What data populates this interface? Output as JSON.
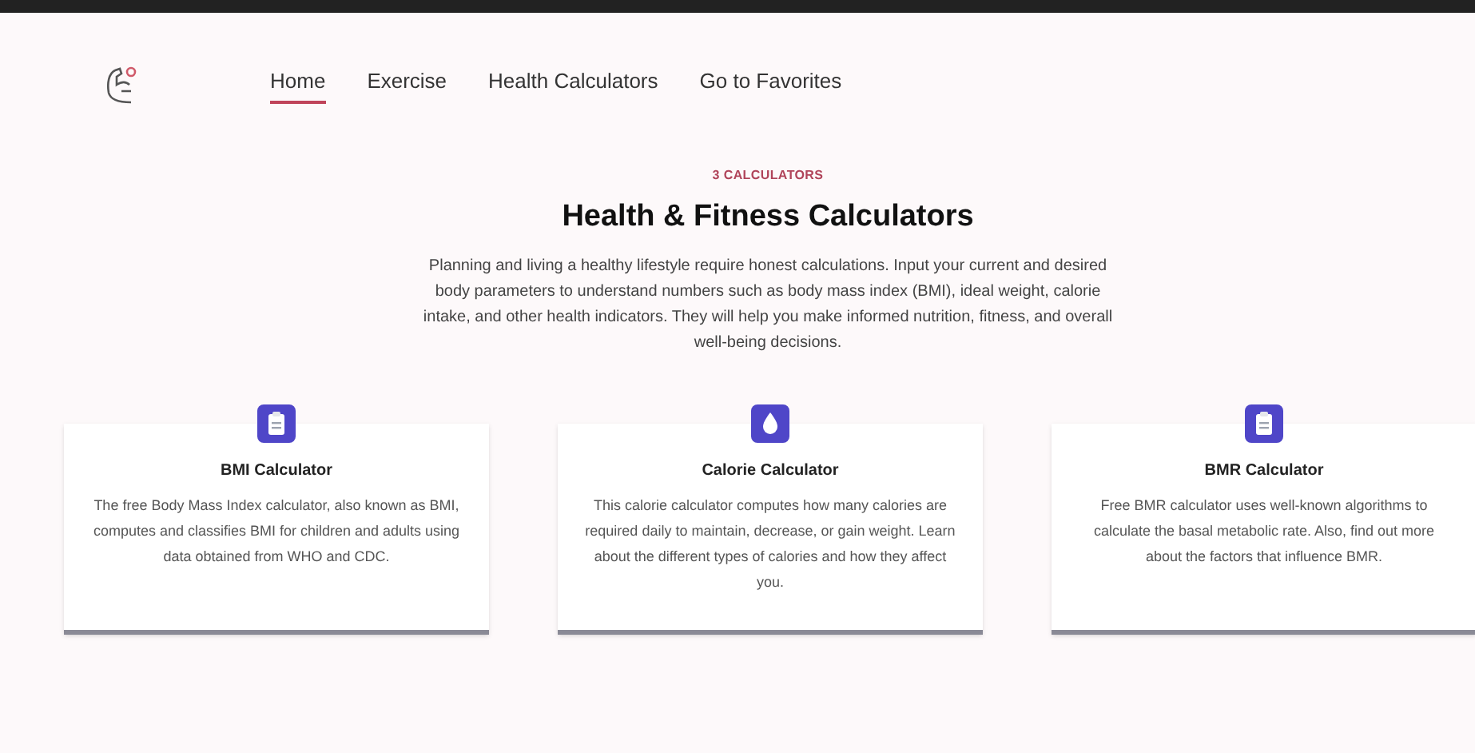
{
  "nav": {
    "items": [
      {
        "label": "Home",
        "selected": true
      },
      {
        "label": "Exercise",
        "selected": false
      },
      {
        "label": "Health Calculators",
        "selected": false
      },
      {
        "label": "Go to Favorites",
        "selected": false
      }
    ]
  },
  "hero": {
    "eyebrow": "3 CALCULATORS",
    "title": "Health & Fitness Calculators",
    "description": "Planning and living a healthy lifestyle require honest calculations. Input your current and desired body parameters to understand numbers such as body mass index (BMI), ideal weight, calorie intake, and other health indicators. They will help you make informed nutrition, fitness, and overall well-being decisions."
  },
  "cards": [
    {
      "kind": "clipboard",
      "title": "BMI Calculator",
      "description": "The free Body Mass Index calculator, also known as BMI, computes and classifies BMI for children and adults using data obtained from WHO and CDC."
    },
    {
      "kind": "drop",
      "title": "Calorie Calculator",
      "description": "This calorie calculator computes how many calories are required daily to maintain, decrease, or gain weight. Learn about the different types of calories and how they affect you."
    },
    {
      "kind": "clipboard",
      "title": "BMR Calculator",
      "description": "Free BMR calculator uses well-known algorithms to calculate the basal metabolic rate. Also, find out more about the factors that influence BMR."
    }
  ]
}
